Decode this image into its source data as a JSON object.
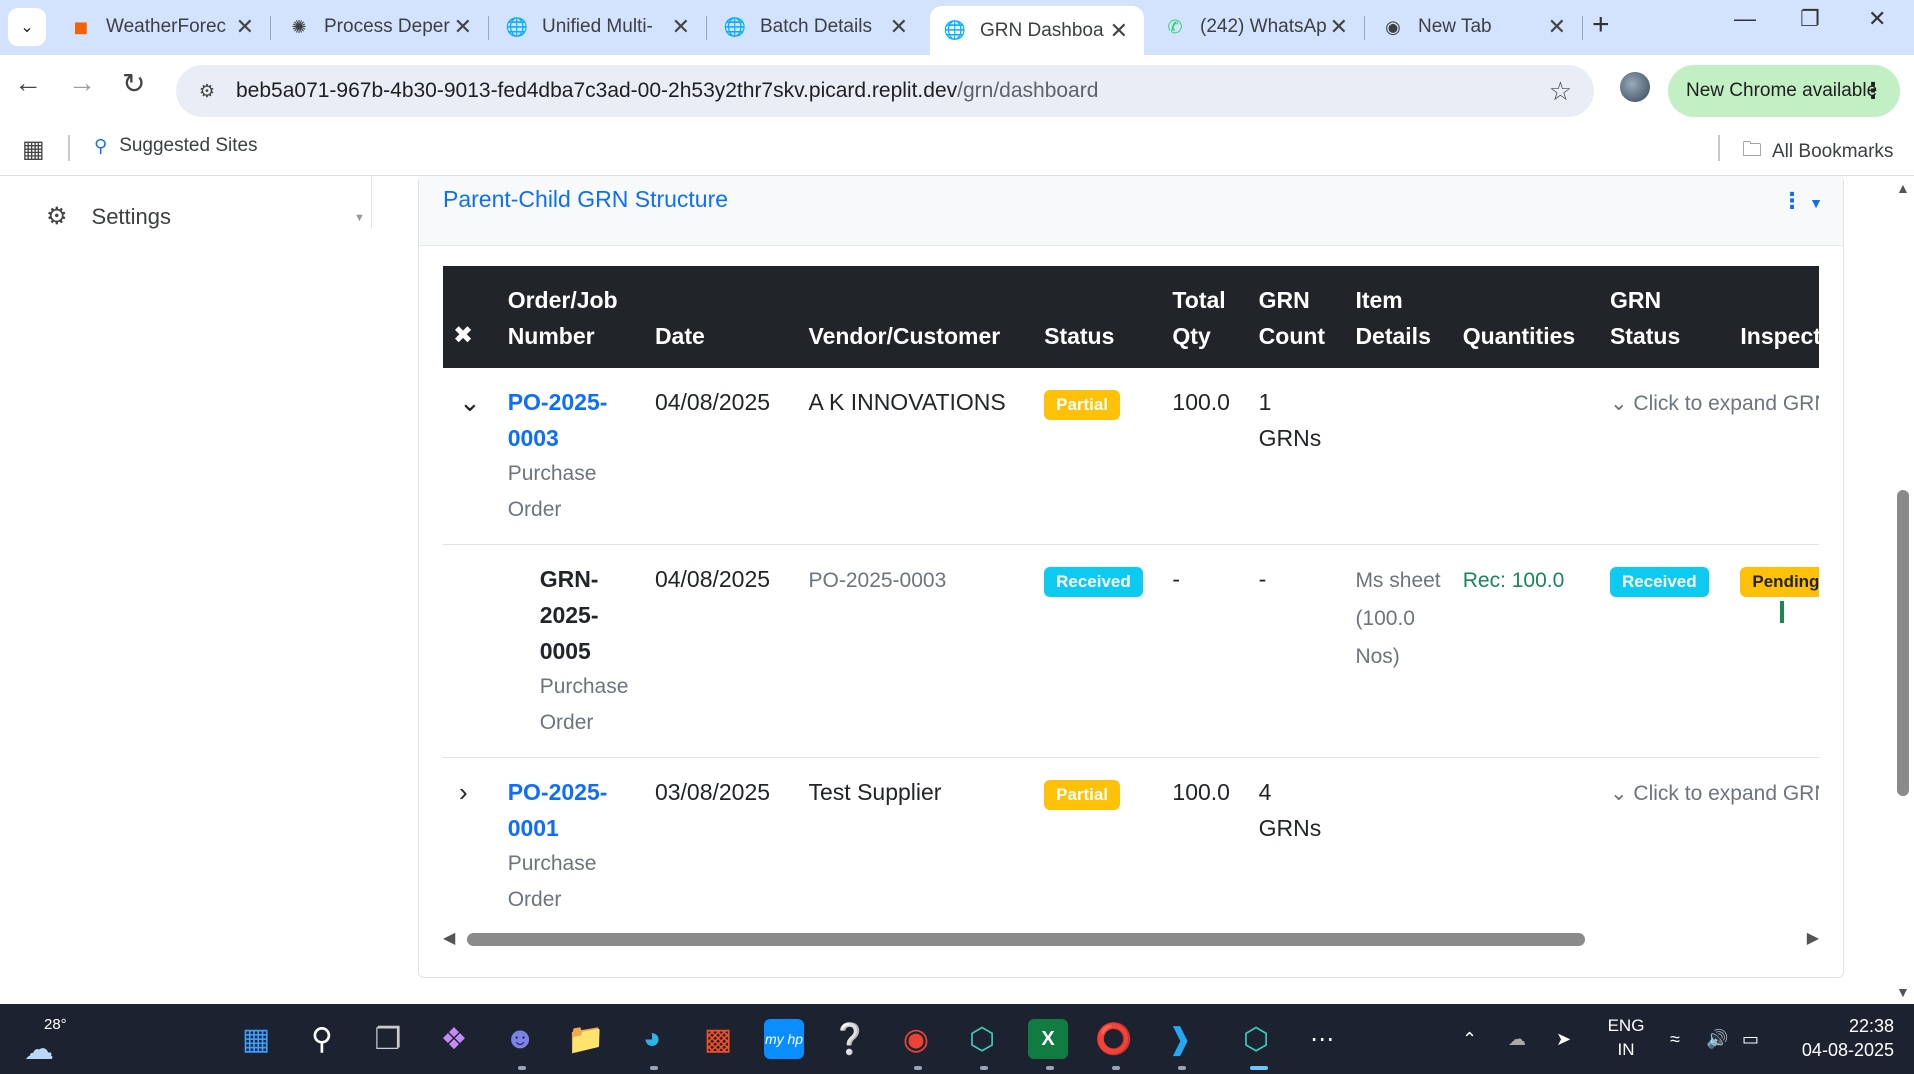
{
  "browser": {
    "tabs": [
      {
        "title": "WeatherForec",
        "icon": "replit-icon",
        "color": "#f26207"
      },
      {
        "title": "Process Deper",
        "icon": "openai-icon",
        "color": "#1f1f1f"
      },
      {
        "title": "Unified Multi-",
        "icon": "globe-icon",
        "color": "#444444"
      },
      {
        "title": "Batch Details",
        "icon": "globe-icon",
        "color": "#444444"
      },
      {
        "title": "GRN Dashboa",
        "icon": "globe-icon",
        "color": "#444444",
        "active": true
      },
      {
        "title": "(242) WhatsAp",
        "icon": "whatsapp-icon",
        "color": "#25d366"
      },
      {
        "title": "New Tab",
        "icon": "chrome-icon",
        "color": "#444444"
      }
    ],
    "url_host": "beb5a071-967b-4b30-9013-fed4dba7c3ad-00-2h53y2thr7skv.picard.replit.dev",
    "url_path": "/grn/dashboard",
    "update_chip": "New Chrome available",
    "bookmarks": {
      "suggested": "Suggested Sites",
      "all": "All Bookmarks"
    }
  },
  "sidebar": {
    "settings_label": "Settings"
  },
  "card": {
    "title": "Parent-Child GRN Structure"
  },
  "table": {
    "headers": {
      "order": "Order/Job Number",
      "date": "Date",
      "vendor": "Vendor/Customer",
      "status": "Status",
      "total_qty": "Total Qty",
      "grn_count": "GRN Count",
      "item_details": "Item Details",
      "quantities": "Quantities",
      "grn_status": "GRN Status",
      "inspection": "Inspection"
    },
    "rows": [
      {
        "order_number": "PO-2025-0003",
        "order_type": "Purchase Order",
        "date": "04/08/2025",
        "vendor": "A K INNOVATIONS",
        "status": "Partial",
        "total_qty": "100.0",
        "grn_count": "1 GRNs",
        "expand_hint": "Click to expand GRN details"
      },
      {
        "grn_number": "GRN-2025-0005",
        "grn_type": "Purchase Order",
        "date": "04/08/2025",
        "reference": "PO-2025-0003",
        "status": "Received",
        "total_qty": "-",
        "grn_count": "-",
        "item_details": "Ms sheet (100.0 Nos)",
        "quantities": "Rec: 100.0",
        "grn_status": "Received",
        "inspection": "Pending"
      },
      {
        "order_number": "PO-2025-0001",
        "order_type": "Purchase Order",
        "date": "03/08/2025",
        "vendor": "Test Supplier",
        "status": "Partial",
        "total_qty": "100.0",
        "grn_count": "4 GRNs",
        "expand_hint": "Click to expand GRN details"
      }
    ]
  },
  "taskbar": {
    "temperature": "28°",
    "lang_line1": "ENG",
    "lang_line2": "IN",
    "time": "22:38",
    "date": "04-08-2025"
  }
}
